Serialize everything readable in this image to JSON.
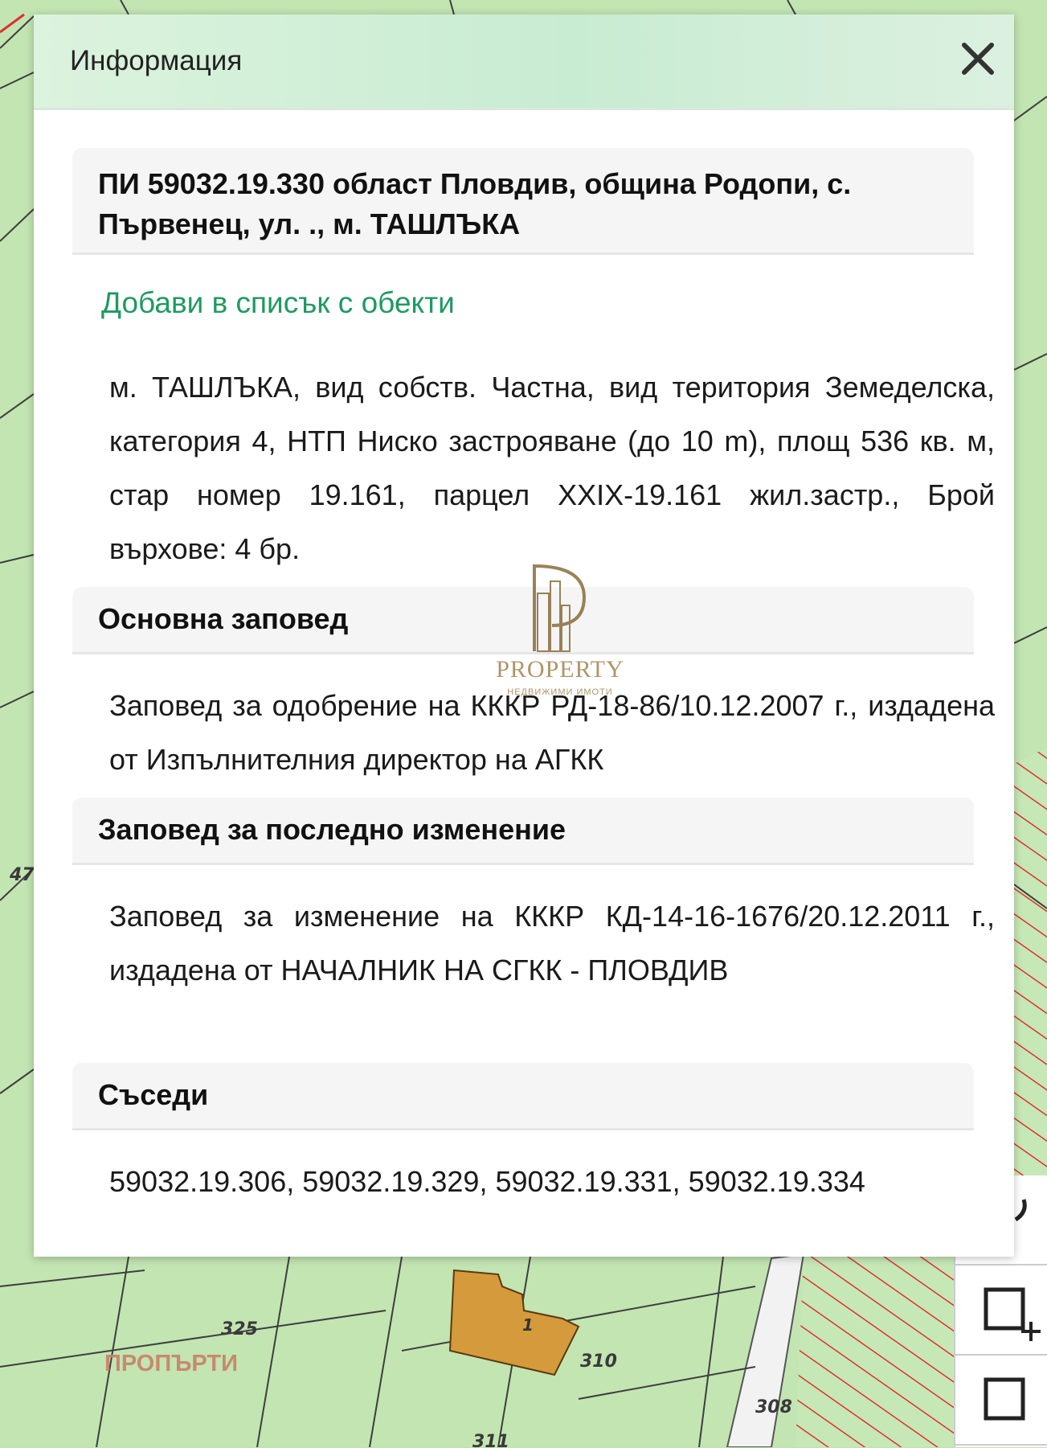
{
  "modal": {
    "title": "Информация",
    "close_icon": "close-icon",
    "parcel_heading": "ПИ 59032.19.330 област Пловдив, община Родопи, с. Първенец, ул. ., м. ТАШЛЪКА",
    "add_link": "Добави в списък с обекти",
    "description": "м. ТАШЛЪКА, вид собств. Частна, вид територия Земеделска, категория 4, НТП Ниско застрояване (до 10 m), площ 536 кв. м, стар номер 19.161, парцел XXIX-19.161 жил.застр., Брой върхове: 4 бр.",
    "main_order_heading": "Основна заповед",
    "main_order_text": "Заповед за одобрение на КККР РД-18-86/10.12.2007 г., издадена от Изпълнителния директор на АГКК",
    "last_order_heading": "Заповед за последно изменение",
    "last_order_text": "Заповед за изменение на КККР КД-14-16-1676/20.12.2011 г., издадена от НАЧАЛНИК НА СГКК - ПЛОВДИВ",
    "neighbors_heading": "Съседи",
    "neighbors_text": "59032.19.306, 59032.19.329, 59032.19.331, 59032.19.334"
  },
  "watermark": {
    "logo_icon": "property-logo-icon",
    "word": "PROPERTY",
    "tagline": "НЕДВИЖИМИ ИМОТИ"
  },
  "map": {
    "labels": [
      "47",
      "325",
      "310",
      "308",
      "311",
      "1"
    ],
    "corner_watermark": "ПРОПЪРТИ",
    "fill_color": "#bfe3ae",
    "building_color": "#d49a3c",
    "hatch_color": "#e03030"
  },
  "toolbar": {
    "icons": [
      "lasso-icon",
      "add-rectangle-icon",
      "select-rectangle-icon"
    ]
  }
}
